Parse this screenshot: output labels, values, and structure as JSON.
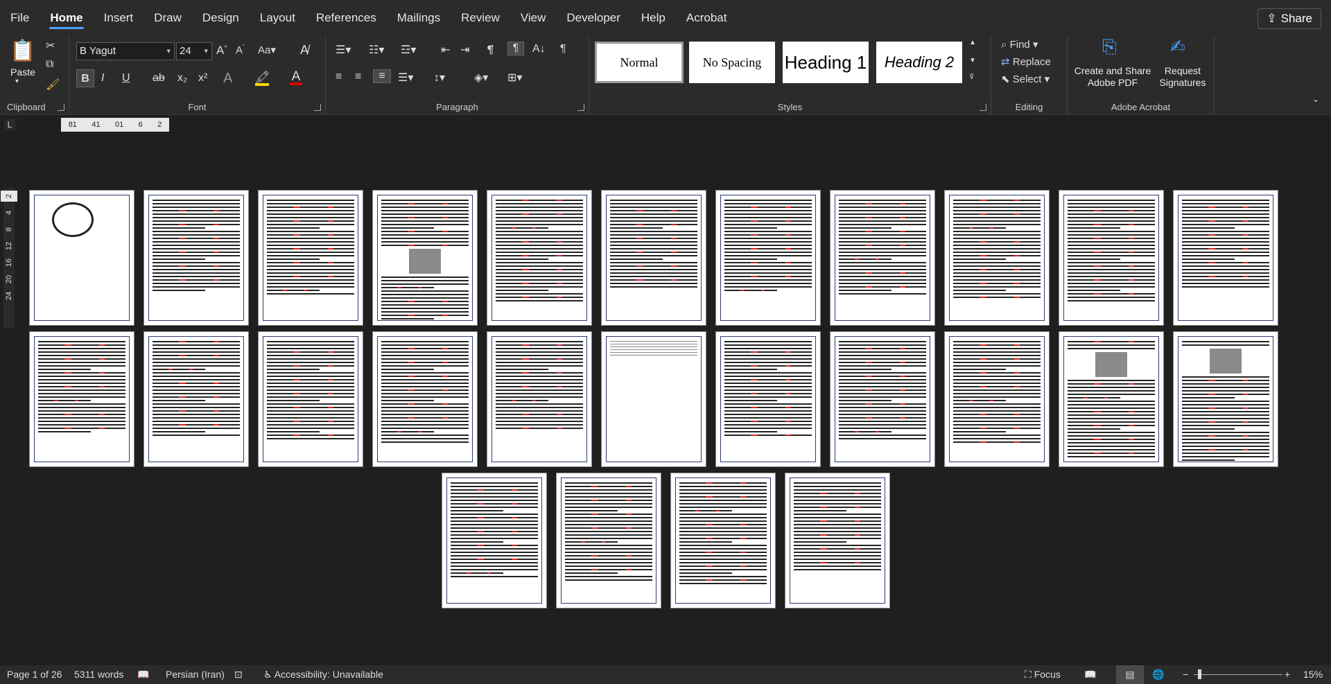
{
  "menu": {
    "items": [
      "File",
      "Home",
      "Insert",
      "Draw",
      "Design",
      "Layout",
      "References",
      "Mailings",
      "Review",
      "View",
      "Developer",
      "Help",
      "Acrobat"
    ],
    "active": "Home",
    "share_label": "Share"
  },
  "ribbon": {
    "clipboard": {
      "paste_label": "Paste",
      "group_label": "Clipboard"
    },
    "font": {
      "family": "B Yagut",
      "size": "24",
      "group_label": "Font",
      "bold": "B",
      "italic": "I",
      "underline": "U",
      "strike": "ab",
      "subscript": "x₂",
      "superscript": "x²",
      "highlight_color": "#ffd400",
      "font_color": "#e00000"
    },
    "paragraph": {
      "group_label": "Paragraph"
    },
    "styles": {
      "group_label": "Styles",
      "items": [
        "Normal",
        "No Spacing",
        "Heading 1",
        "Heading 2"
      ]
    },
    "editing": {
      "group_label": "Editing",
      "find": "Find",
      "replace": "Replace",
      "select": "Select"
    },
    "acrobat": {
      "group_label": "Adobe Acrobat",
      "create_share": "Create and Share Adobe PDF",
      "request": "Request Signatures"
    }
  },
  "ruler": {
    "h_numbers": [
      "81",
      "41",
      "01",
      "6",
      "2"
    ],
    "v_numbers": [
      "2",
      "4",
      "8",
      "12",
      "16",
      "20",
      "24"
    ]
  },
  "status": {
    "page": "Page 1 of 26",
    "words": "5311 words",
    "language": "Persian (Iran)",
    "accessibility": "Accessibility: Unavailable",
    "focus": "Focus",
    "zoom": "15%"
  },
  "document": {
    "page_count": 26
  }
}
